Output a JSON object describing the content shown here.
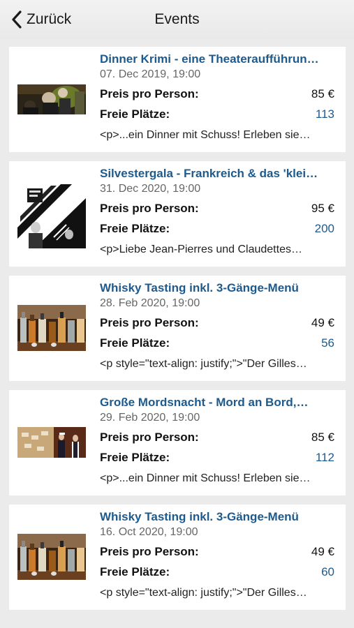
{
  "nav": {
    "back_label": "Zurück",
    "title": "Events"
  },
  "events": [
    {
      "title": "Dinner Krimi - eine Theateraufführun…",
      "date": "07. Dec 2019, 19:00",
      "price_label": "Preis pro Person:",
      "price": "85 €",
      "seats_label": "Freie Plätze:",
      "seats": "113",
      "description": "<p>...ein Dinner mit Schuss! Erleben sie…",
      "image": "dinner-theater-photo"
    },
    {
      "title": "Silvestergala - Frankreich & das 'klei…",
      "date": "31. Dec 2020, 19:00",
      "price_label": "Preis pro Person:",
      "price": "95 €",
      "seats_label": "Freie Plätze:",
      "seats": "200",
      "description": "<p>Liebe Jean-Pierres und Claudettes…",
      "image": "silvester-poster"
    },
    {
      "title": "Whisky Tasting inkl. 3-Gänge-Menü",
      "date": "28. Feb 2020, 19:00",
      "price_label": "Preis pro Person:",
      "price": "49 €",
      "seats_label": "Freie Plätze:",
      "seats": "56",
      "description": "<p style=\"text-align: justify;\">\"Der Gilles…",
      "image": "whisky-bottles-photo"
    },
    {
      "title": "Große Mordsnacht - Mord an Bord,…",
      "date": "29. Feb 2020, 19:00",
      "price_label": "Preis pro Person:",
      "price": "85 €",
      "seats_label": "Freie Plätze:",
      "seats": "112",
      "description": "<p>...ein Dinner mit Schuss! Erleben sie…",
      "image": "mordsnacht-photo"
    },
    {
      "title": "Whisky Tasting inkl. 3-Gänge-Menü",
      "date": "16. Oct 2020, 19:00",
      "price_label": "Preis pro Person:",
      "price": "49 €",
      "seats_label": "Freie Plätze:",
      "seats": "60",
      "description": "<p style=\"text-align: justify;\">\"Der Gilles…",
      "image": "whisky-bottles-photo"
    }
  ],
  "colors": {
    "title_blue": "#1d5a8e",
    "background": "#ebebeb",
    "card": "#ffffff"
  }
}
